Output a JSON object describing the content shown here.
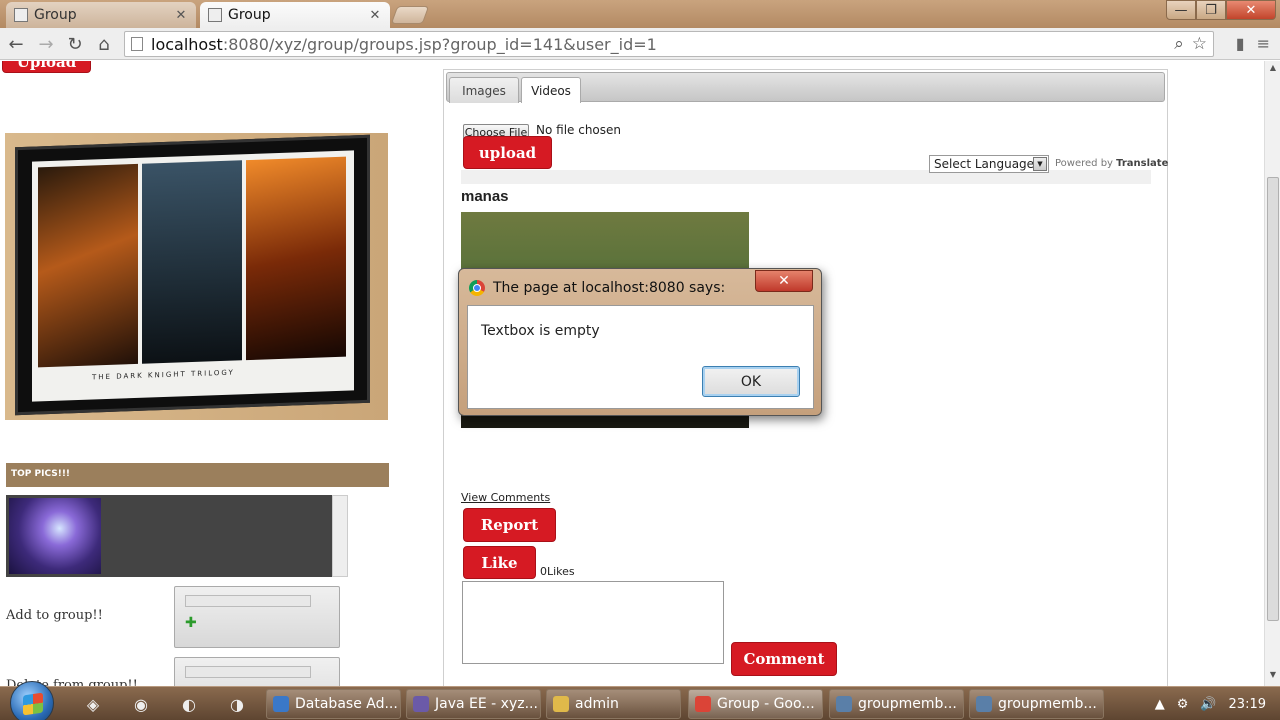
{
  "browser": {
    "tabs": [
      {
        "label": "Group",
        "active": false
      },
      {
        "label": "Group",
        "active": true
      }
    ],
    "url_host": "localhost",
    "url_rest": ":8080/xyz/group/groups.jsp?group_id=141&user_id=1"
  },
  "left": {
    "upload_label": "Upload",
    "top_pics_header": "TOP PICS!!!",
    "add_label": "Add to group!!",
    "delete_label": "Delete from group!!"
  },
  "panel": {
    "tabs": [
      "Images",
      "Videos"
    ],
    "choose_file": "Choose File",
    "no_file": "No file chosen",
    "upload_label": "upload",
    "language_select": "Select Language",
    "powered_by": "Powered by",
    "translate": "Translate",
    "video_title": "manas",
    "view_comments": "View Comments",
    "report_label": "Report",
    "like_label": "Like",
    "likes_text": "0Likes",
    "comment_label": "Comment"
  },
  "dialog": {
    "title": "The page at localhost:8080 says:",
    "message": "Textbox is empty",
    "ok_label": "OK"
  },
  "taskbar": {
    "items": [
      {
        "label": "Database Ad...",
        "color": "#3a78c8"
      },
      {
        "label": "Java EE - xyz...",
        "color": "#6b5aa8"
      },
      {
        "label": "admin",
        "color": "#e0b94a"
      },
      {
        "label": "Group - Goo...",
        "color": "#db4437"
      },
      {
        "label": "groupmemb...",
        "color": "#5a7fa8"
      },
      {
        "label": "groupmemb...",
        "color": "#5a7fa8"
      }
    ],
    "clock": "23:19"
  },
  "colors": {
    "accent_red": "#d61a23",
    "top_pics_bar": "#9b7f5c"
  }
}
